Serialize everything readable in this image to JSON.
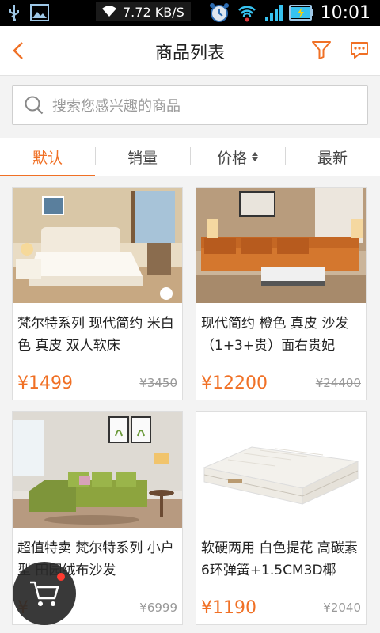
{
  "status_bar": {
    "net_speed": "7.72 KB/S",
    "time": "10:01",
    "icons": [
      "usb-icon",
      "image-icon",
      "wifi-icon",
      "alarm-icon",
      "hotspot-icon",
      "signal-icon",
      "battery-icon"
    ]
  },
  "header": {
    "title": "商品列表",
    "back_icon": "chevron-left-icon",
    "filter_icon": "filter-icon",
    "message_icon": "chat-icon"
  },
  "search": {
    "placeholder": "搜索您感兴趣的商品"
  },
  "tabs": [
    {
      "label": "默认",
      "active": true
    },
    {
      "label": "销量",
      "active": false
    },
    {
      "label": "价格",
      "active": false,
      "sortable": true
    },
    {
      "label": "最新",
      "active": false
    }
  ],
  "products": [
    {
      "name": "梵尔特系列 现代简约 米白色 真皮 双人软床",
      "price": "¥1499",
      "old_price": "¥3450"
    },
    {
      "name": "现代简约 橙色 真皮 沙发（1+3+贵）面右贵妃",
      "price": "¥12200",
      "old_price": "¥24400"
    },
    {
      "name": "超值特卖 梵尔特系列 小户型 田园绒布沙发",
      "price": "¥",
      "old_price": "¥6999"
    },
    {
      "name": "软硬两用 白色提花 高碳素6环弹簧+1.5CM3D椰",
      "price": "¥1190",
      "old_price": "¥2040"
    }
  ],
  "colors": {
    "accent": "#f07025",
    "badge": "#ff3b30"
  }
}
